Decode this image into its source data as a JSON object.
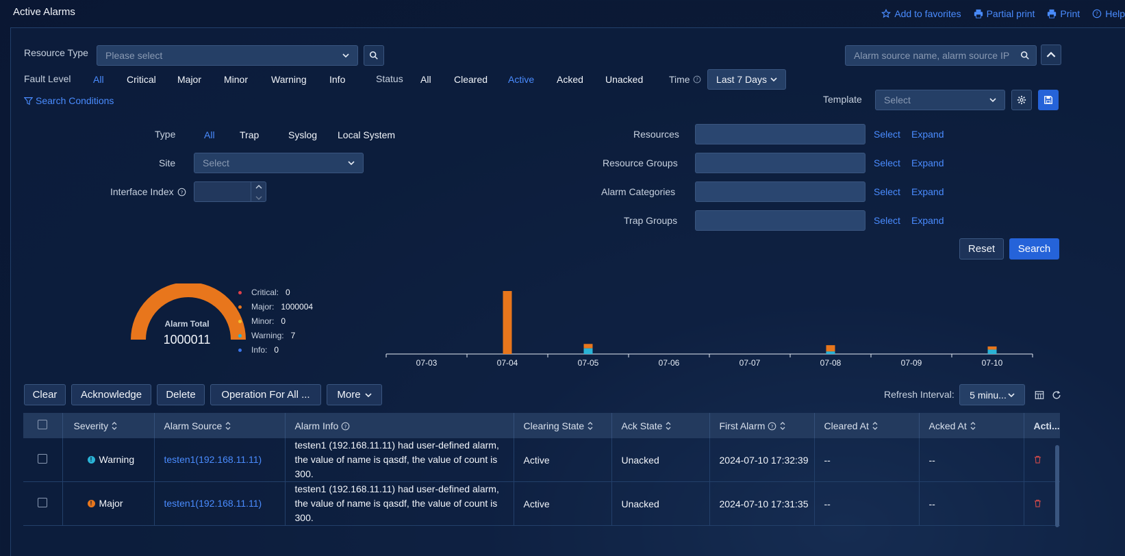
{
  "header": {
    "title": "Active Alarms",
    "add_favorites": "Add to favorites",
    "partial_print": "Partial print",
    "print": "Print",
    "help": "Help"
  },
  "filters": {
    "resource_type_label": "Resource Type",
    "resource_type_placeholder": "Please select",
    "search_placeholder": "Alarm source name, alarm source IP",
    "fault_level_label": "Fault Level",
    "fault_levels": [
      "All",
      "Critical",
      "Major",
      "Minor",
      "Warning",
      "Info"
    ],
    "status_label": "Status",
    "statuses": [
      "All",
      "Cleared",
      "Active",
      "Acked",
      "Unacked"
    ],
    "time_label": "Time",
    "time_value": "Last 7 Days",
    "search_conditions": "Search Conditions",
    "template_label": "Template",
    "template_placeholder": "Select",
    "type_label": "Type",
    "types": [
      "All",
      "Trap",
      "Syslog",
      "Local System"
    ],
    "site_label": "Site",
    "site_placeholder": "Select",
    "interface_index_label": "Interface Index",
    "resources_label": "Resources",
    "resource_groups_label": "Resource Groups",
    "alarm_categories_label": "Alarm Categories",
    "trap_groups_label": "Trap Groups",
    "select_link": "Select",
    "expand_link": "Expand",
    "reset": "Reset",
    "search": "Search"
  },
  "summary": {
    "gauge_title": "Alarm Total",
    "gauge_total": "1000011",
    "legend": [
      {
        "name": "Critical:",
        "value": "0",
        "color": "#e0404a"
      },
      {
        "name": "Major:",
        "value": "1000004",
        "color": "#e8761c"
      },
      {
        "name": "Minor:",
        "value": "0",
        "color": "#f2c12e"
      },
      {
        "name": "Warning:",
        "value": "7",
        "color": "#2ab3d6"
      },
      {
        "name": "Info:",
        "value": "0",
        "color": "#3a74e8"
      }
    ]
  },
  "chart_data": {
    "type": "bar",
    "categories": [
      "07-03",
      "07-04",
      "07-05",
      "07-06",
      "07-07",
      "07-08",
      "07-09",
      "07-10"
    ],
    "series": [
      {
        "values": [
          0,
          1000000,
          1,
          0,
          0,
          1,
          0,
          2
        ],
        "color": "#e8761c"
      },
      {
        "values": [
          0,
          0,
          2,
          0,
          0,
          1,
          0,
          2
        ],
        "color": "#2ab3d6"
      }
    ],
    "bar_heights_relative": [
      0,
      1.0,
      0.16,
      0,
      0,
      0.14,
      0,
      0.12
    ],
    "cyan_relative": [
      0,
      0,
      0.09,
      0,
      0,
      0.04,
      0,
      0.07
    ]
  },
  "toolbar": {
    "clear": "Clear",
    "acknowledge": "Acknowledge",
    "delete": "Delete",
    "operation_all": "Operation For All ...",
    "more": "More",
    "refresh_label": "Refresh Interval:",
    "refresh_value": "5 minu..."
  },
  "table": {
    "columns": [
      "Severity",
      "Alarm Source",
      "Alarm Info",
      "Clearing State",
      "Ack State",
      "First Alarm",
      "Cleared At",
      "Acked At",
      "Acti..."
    ],
    "rows": [
      {
        "severity": "Warning",
        "severity_color": "#2ab3d6",
        "source": "testen1(192.168.11.11)",
        "info": "testen1  (192.168.11.11)   had user-defined alarm, the value of name is qasdf,  the value of count is 300.",
        "clearing": "Active",
        "ack": "Unacked",
        "first": "2024-07-10 17:32:39",
        "cleared": "--",
        "acked": "--"
      },
      {
        "severity": "Major",
        "severity_color": "#e8761c",
        "source": "testen1(192.168.11.11)",
        "info": "testen1  (192.168.11.11)   had user-defined alarm, the value of name is qasdf,  the value of count is 300.",
        "clearing": "Active",
        "ack": "Unacked",
        "first": "2024-07-10 17:31:35",
        "cleared": "--",
        "acked": "--"
      }
    ]
  }
}
